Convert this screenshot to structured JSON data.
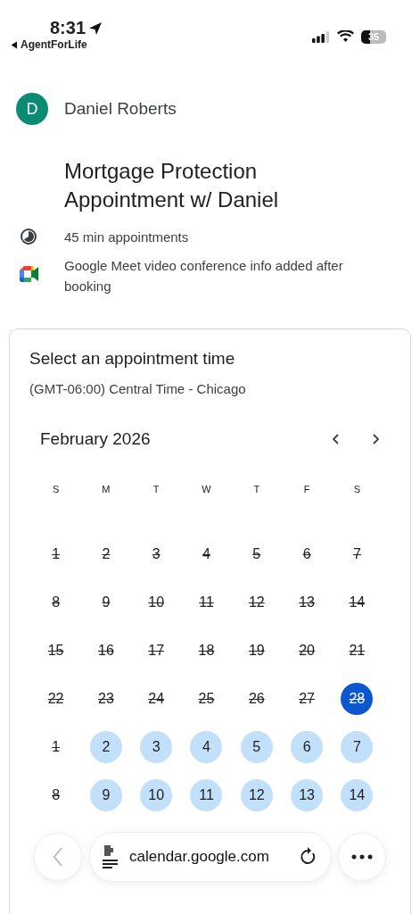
{
  "status_bar": {
    "time": "8:31",
    "back_app": "AgentForLife",
    "battery": "35"
  },
  "host": {
    "initial": "D",
    "name": "Daniel Roberts"
  },
  "title": "Mortgage Protection Appointment w/ Daniel",
  "details": [
    {
      "kind": "duration",
      "text": "45 min appointments"
    },
    {
      "kind": "meet",
      "text": "Google Meet video conference info added after booking"
    }
  ],
  "picker": {
    "heading": "Select an appointment time",
    "timezone": "(GMT-06:00) Central Time - Chicago",
    "month": "February 2026",
    "weekdays": [
      "S",
      "M",
      "T",
      "W",
      "T",
      "F",
      "S"
    ],
    "weeks": [
      [
        {
          "label": "1",
          "available": false,
          "selected": false
        },
        {
          "label": "2",
          "available": false,
          "selected": false
        },
        {
          "label": "3",
          "available": false,
          "selected": false
        },
        {
          "label": "4",
          "available": false,
          "selected": false
        },
        {
          "label": "5",
          "available": false,
          "selected": false
        },
        {
          "label": "6",
          "available": false,
          "selected": false
        },
        {
          "label": "7",
          "available": false,
          "selected": false
        }
      ],
      [
        {
          "label": "8",
          "available": false,
          "selected": false
        },
        {
          "label": "9",
          "available": false,
          "selected": false
        },
        {
          "label": "10",
          "available": false,
          "selected": false
        },
        {
          "label": "11",
          "available": false,
          "selected": false
        },
        {
          "label": "12",
          "available": false,
          "selected": false
        },
        {
          "label": "13",
          "available": false,
          "selected": false
        },
        {
          "label": "14",
          "available": false,
          "selected": false
        }
      ],
      [
        {
          "label": "15",
          "available": false,
          "selected": false
        },
        {
          "label": "16",
          "available": false,
          "selected": false
        },
        {
          "label": "17",
          "available": false,
          "selected": false
        },
        {
          "label": "18",
          "available": false,
          "selected": false
        },
        {
          "label": "19",
          "available": false,
          "selected": false
        },
        {
          "label": "20",
          "available": false,
          "selected": false
        },
        {
          "label": "21",
          "available": false,
          "selected": false
        }
      ],
      [
        {
          "label": "22",
          "available": false,
          "selected": false
        },
        {
          "label": "23",
          "available": false,
          "selected": false
        },
        {
          "label": "24",
          "available": false,
          "selected": false
        },
        {
          "label": "25",
          "available": false,
          "selected": false
        },
        {
          "label": "26",
          "available": false,
          "selected": false
        },
        {
          "label": "27",
          "available": false,
          "selected": false
        },
        {
          "label": "28",
          "available": false,
          "selected": true
        }
      ],
      [
        {
          "label": "1",
          "available": false,
          "selected": false
        },
        {
          "label": "2",
          "available": true,
          "selected": false
        },
        {
          "label": "3",
          "available": true,
          "selected": false
        },
        {
          "label": "4",
          "available": true,
          "selected": false
        },
        {
          "label": "5",
          "available": true,
          "selected": false
        },
        {
          "label": "6",
          "available": true,
          "selected": false
        },
        {
          "label": "7",
          "available": true,
          "selected": false
        }
      ],
      [
        {
          "label": "8",
          "available": false,
          "selected": false
        },
        {
          "label": "9",
          "available": true,
          "selected": false
        },
        {
          "label": "10",
          "available": true,
          "selected": false
        },
        {
          "label": "11",
          "available": true,
          "selected": false
        },
        {
          "label": "12",
          "available": true,
          "selected": false
        },
        {
          "label": "13",
          "available": true,
          "selected": false
        },
        {
          "label": "14",
          "available": true,
          "selected": false
        }
      ]
    ]
  },
  "browser_bar": {
    "url": "calendar.google.com"
  }
}
